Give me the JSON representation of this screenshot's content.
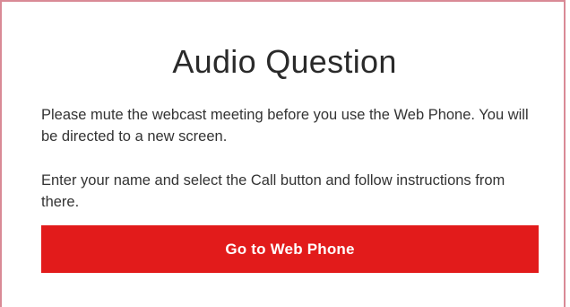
{
  "dialog": {
    "title": "Audio Question",
    "paragraph_1": "Please mute the webcast meeting before you use the Web Phone. You will be directed to a new screen.",
    "paragraph_2": "Enter your name and select the Call button and follow instructions from there.",
    "button_label": "Go to Web Phone"
  },
  "colors": {
    "button_bg": "#e21b1b",
    "button_text": "#ffffff",
    "frame_border": "#d98a96",
    "text": "#333333"
  }
}
